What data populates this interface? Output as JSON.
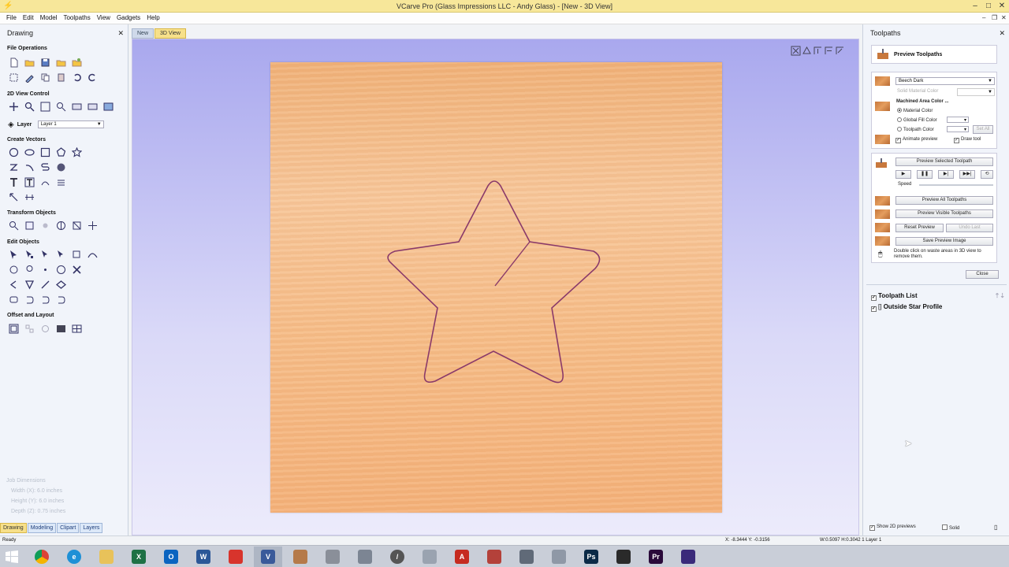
{
  "window": {
    "title": "VCarve Pro (Glass Impressions LLC - Andy Glass) - [New - 3D View]"
  },
  "menu": [
    "File",
    "Edit",
    "Model",
    "Toolpaths",
    "View",
    "Gadgets",
    "Help"
  ],
  "drawing": {
    "title": "Drawing",
    "sections": {
      "file_operations": "File Operations",
      "view_control": "2D View Control",
      "layer": "Layer",
      "layer_value": "Layer 1",
      "create_vectors": "Create Vectors",
      "transform_objects": "Transform Objects",
      "edit_objects": "Edit Objects",
      "offset_layout": "Offset and Layout"
    },
    "job_info": {
      "heading": "Job Dimensions",
      "width": "Width  (X): 6.0 inches",
      "height": "Height (Y): 6.0 inches",
      "depth": "Depth  (Z): 0.75 inches"
    },
    "bottom_tabs": [
      {
        "label": "Drawing",
        "active": true
      },
      {
        "label": "Modeling",
        "active": false
      },
      {
        "label": "Clipart",
        "active": false
      },
      {
        "label": "Layers",
        "active": false
      }
    ]
  },
  "view_tabs": [
    {
      "label": "New",
      "active": false
    },
    {
      "label": "3D View",
      "active": true
    }
  ],
  "toolpaths": {
    "title": "Toolpaths",
    "preview_title": "Preview Toolpaths",
    "material": "Beech Dark",
    "solid_material_color": "Solid Material Color",
    "machined_area_color": "Machined Area Color ...",
    "material_color": "Material Color",
    "global_fill_color": "Global Fill Color",
    "toolpath_color": "Toolpath Color",
    "set_all": "Set All",
    "animate_preview": "Animate preview",
    "draw_tool": "Draw tool",
    "preview_selected": "Preview Selected Toolpath",
    "speed": "Speed",
    "preview_all": "Preview All Toolpaths",
    "preview_visible": "Preview Visible Toolpaths",
    "reset_preview": "Reset Preview",
    "undo_last": "Undo Last",
    "save_preview_image": "Save Preview Image",
    "hint": "Double click on waste areas in 3D view to remove them.",
    "close": "Close",
    "list_header": "Toolpath List",
    "items": [
      "Outside Star Profile"
    ],
    "show_2d": "Show 2D previews",
    "solid": "Solid"
  },
  "status": {
    "left": "Ready",
    "coords": "X: -8.3444 Y: -0.3156",
    "size": "W:0.5097  H:0.3042  1 Layer 1"
  },
  "colors": {
    "accent_yellow": "#f7e08a",
    "star_outline": "#8a3a6a",
    "board": "#f6bd88"
  }
}
